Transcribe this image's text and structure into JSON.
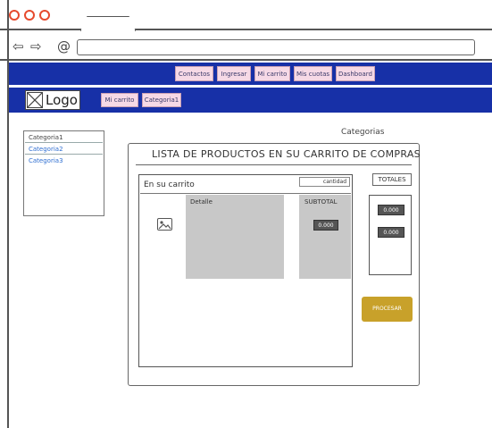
{
  "browser": {
    "back_icon": "back-arrow-icon",
    "forward_icon": "forward-arrow-icon",
    "home_icon": "home-at-icon",
    "window_dots_colors": [
      "#e64a2e",
      "#e64a2e",
      "#e64a2e"
    ]
  },
  "topnav": {
    "items": [
      "Contactos",
      "Ingresar",
      "Mi carrito",
      "Mis cuotas",
      "Dashboard"
    ]
  },
  "secondnav": {
    "logo_text": "Logo",
    "items": [
      "Mi carrito",
      "Categoria1"
    ]
  },
  "categories": {
    "title": "Categorias",
    "items": [
      "Categoria1",
      "Categoria2",
      "Categoria3"
    ]
  },
  "main": {
    "title": "LISTA DE PRODUCTOS EN SU CARRITO DE COMPRAS",
    "cart_label": "En su carrito",
    "quantity_label": "cantidad",
    "detail_label": "Detalle",
    "subtotal_label": "SUBTOTAL",
    "subtotal_value": "0.000",
    "totals_label": "TOTALES",
    "totals_values": [
      "0.000",
      "0.000"
    ],
    "process_button": "PROCESAR"
  },
  "colors": {
    "nav_blue": "#1730a7",
    "nav_item_pink": "#f6d9e6",
    "process_gold": "#c8a12a",
    "placeholder_gray": "#c8c8c8"
  }
}
